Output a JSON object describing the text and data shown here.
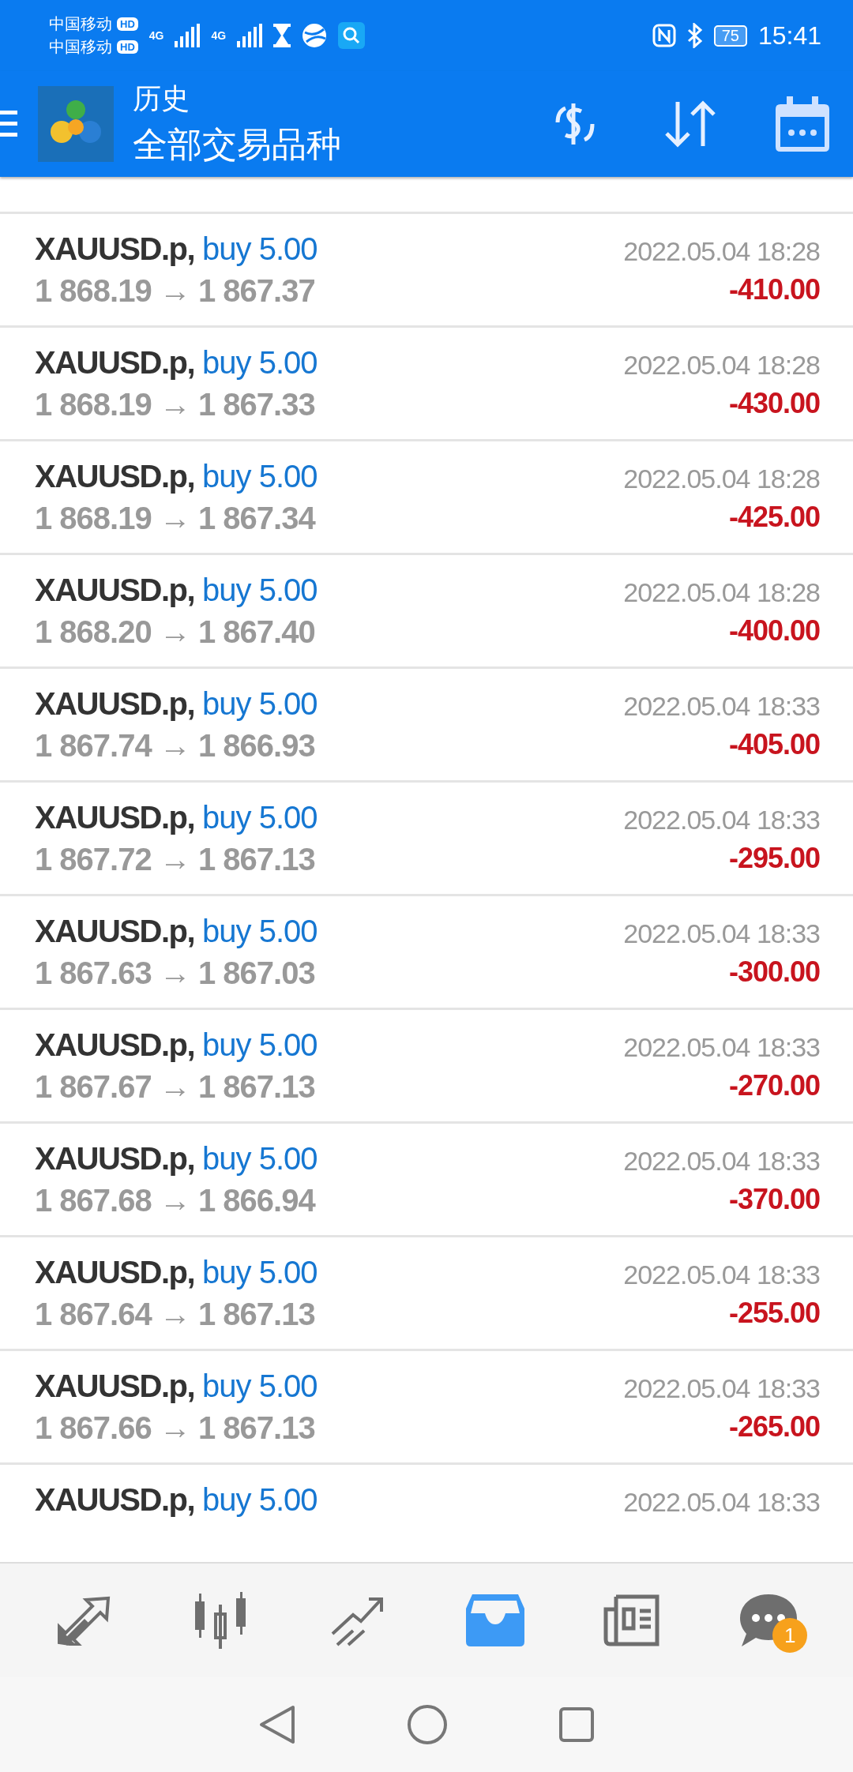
{
  "status_bar": {
    "carriers": [
      {
        "name": "中国移动",
        "badge": "HD",
        "network": "4G"
      },
      {
        "name": "中国移动",
        "badge": "HD",
        "network": "4G"
      }
    ],
    "battery": "75",
    "time": "15:41"
  },
  "header": {
    "title": "历史",
    "subtitle": "全部交易品种"
  },
  "deals": [
    {
      "symbol": "XAUUSD.p,",
      "side": "buy 5.00",
      "prices": "1 868.19 → 1 867.37",
      "time": "2022.05.04 18:28",
      "profit": "-410.00"
    },
    {
      "symbol": "XAUUSD.p,",
      "side": "buy 5.00",
      "prices": "1 868.19 → 1 867.33",
      "time": "2022.05.04 18:28",
      "profit": "-430.00"
    },
    {
      "symbol": "XAUUSD.p,",
      "side": "buy 5.00",
      "prices": "1 868.19 → 1 867.34",
      "time": "2022.05.04 18:28",
      "profit": "-425.00"
    },
    {
      "symbol": "XAUUSD.p,",
      "side": "buy 5.00",
      "prices": "1 868.20 → 1 867.40",
      "time": "2022.05.04 18:28",
      "profit": "-400.00"
    },
    {
      "symbol": "XAUUSD.p,",
      "side": "buy 5.00",
      "prices": "1 867.74 → 1 866.93",
      "time": "2022.05.04 18:33",
      "profit": "-405.00"
    },
    {
      "symbol": "XAUUSD.p,",
      "side": "buy 5.00",
      "prices": "1 867.72 → 1 867.13",
      "time": "2022.05.04 18:33",
      "profit": "-295.00"
    },
    {
      "symbol": "XAUUSD.p,",
      "side": "buy 5.00",
      "prices": "1 867.63 → 1 867.03",
      "time": "2022.05.04 18:33",
      "profit": "-300.00"
    },
    {
      "symbol": "XAUUSD.p,",
      "side": "buy 5.00",
      "prices": "1 867.67 → 1 867.13",
      "time": "2022.05.04 18:33",
      "profit": "-270.00"
    },
    {
      "symbol": "XAUUSD.p,",
      "side": "buy 5.00",
      "prices": "1 867.68 → 1 866.94",
      "time": "2022.05.04 18:33",
      "profit": "-370.00"
    },
    {
      "symbol": "XAUUSD.p,",
      "side": "buy 5.00",
      "prices": "1 867.64 → 1 867.13",
      "time": "2022.05.04 18:33",
      "profit": "-255.00"
    },
    {
      "symbol": "XAUUSD.p,",
      "side": "buy 5.00",
      "prices": "1 867.66 → 1 867.13",
      "time": "2022.05.04 18:33",
      "profit": "-265.00"
    },
    {
      "symbol": "XAUUSD.p,",
      "side": "buy 5.00",
      "time": "2022.05.04 18:33"
    }
  ],
  "bottom_nav": [
    {
      "kind": "quotes",
      "selected": false
    },
    {
      "kind": "chart",
      "selected": false
    },
    {
      "kind": "trade",
      "selected": false
    },
    {
      "kind": "history",
      "selected": true
    },
    {
      "kind": "news",
      "selected": false
    },
    {
      "kind": "chat",
      "selected": false,
      "badge": "1"
    }
  ]
}
